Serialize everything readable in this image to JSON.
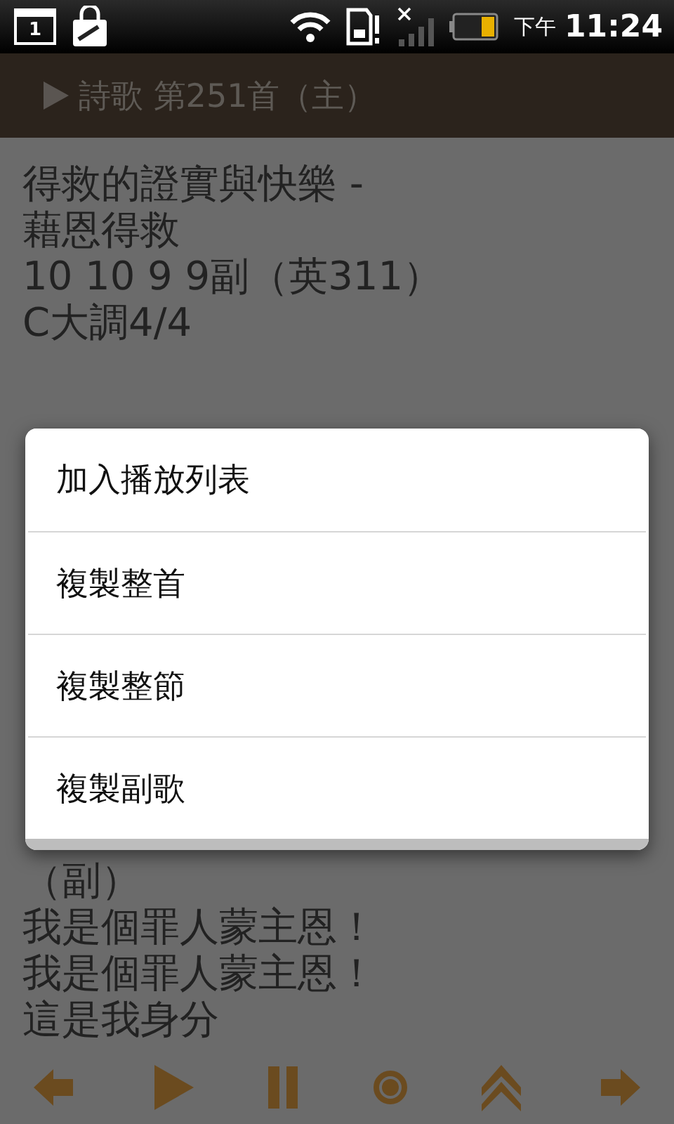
{
  "status_bar": {
    "calendar_day": "1",
    "ampm": "下午",
    "time": "11:24"
  },
  "title_bar": {
    "title": "詩歌 第251首（主）"
  },
  "song_header": [
    "得救的證實與快樂 -",
    "藉恩得救",
    "10 10 9 9副（英311）",
    "C大調4/4"
  ],
  "lyrics_visible": [
    "（副）",
    "我是個罪人蒙主恩！",
    "我是個罪人蒙主恩！",
    "這是我身分"
  ],
  "context_menu": {
    "items": [
      {
        "label": "加入播放列表"
      },
      {
        "label": "複製整首"
      },
      {
        "label": "複製整節"
      },
      {
        "label": "複製副歌"
      }
    ]
  }
}
